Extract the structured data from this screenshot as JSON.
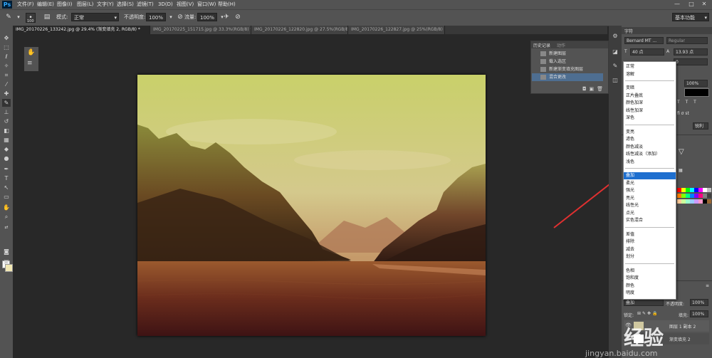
{
  "app": {
    "logo": "Ps"
  },
  "menubar": {
    "items": [
      "文件(F)",
      "编辑(E)",
      "图像(I)",
      "图层(L)",
      "文字(Y)",
      "选择(S)",
      "滤镜(T)",
      "3D(D)",
      "视图(V)",
      "窗口(W)",
      "帮助(H)"
    ],
    "window_buttons": [
      "—",
      "□",
      "✕"
    ]
  },
  "options_bar": {
    "brush_size": "100",
    "mode_label": "模式:",
    "mode_value": "正常",
    "opacity_label": "不透明度:",
    "opacity_value": "100%",
    "flow_label": "流量:",
    "flow_value": "100%",
    "workspace": "基本功能"
  },
  "tabs": [
    {
      "label": "IMG_20170226_133242.jpg @ 29.4% (渐变填充 2, RGB/8) *",
      "active": true
    },
    {
      "label": "IMG_20170225_151715.jpg @ 33.3%(RGB/8) *",
      "active": false
    },
    {
      "label": "IMG_20170226_122820.jpg @ 27.5%(RGB/8) *",
      "active": false
    },
    {
      "label": "IMG_20170226_122827.jpg @ 25%(RGB/8) *",
      "active": false
    }
  ],
  "history_panel": {
    "tabs": [
      "历史记录",
      "动作"
    ],
    "items": [
      {
        "label": "新建图层",
        "selected": false
      },
      {
        "label": "载入选区",
        "selected": false
      },
      {
        "label": "新建渐变填充图层",
        "selected": false
      },
      {
        "label": "混合更改",
        "selected": true
      }
    ]
  },
  "character_panel": {
    "tab": "字符",
    "font_family": "Bernard MT ...",
    "font_style": "Regular",
    "font_size": "40 点",
    "leading": "13.93 点",
    "tracking": "0",
    "scale": "100%",
    "antialias": "锐利"
  },
  "blend_modes": {
    "groups": [
      [
        "正常",
        "溶解"
      ],
      [
        "变暗",
        "正片叠底",
        "颜色加深",
        "线性加深",
        "深色"
      ],
      [
        "变亮",
        "滤色",
        "颜色减淡",
        "线性减淡（添加）",
        "浅色"
      ],
      [
        "叠加",
        "柔光",
        "强光",
        "亮光",
        "线性光",
        "点光",
        "实色混合"
      ],
      [
        "差值",
        "排除",
        "减去",
        "划分"
      ],
      [
        "色相",
        "饱和度",
        "颜色",
        "明度"
      ]
    ],
    "selected": "叠加"
  },
  "layers_panel": {
    "blend_mode": "叠加",
    "opacity_label": "不透明度:",
    "opacity_value": "100%",
    "lock_label": "锁定:",
    "fill_label": "填充:",
    "fill_value": "100%",
    "layers": [
      "图层 1 副本 2",
      "渐变填充 2"
    ]
  },
  "watermark": {
    "text": "经验",
    "subtext": "jingyan.baidu.com"
  },
  "colors": {
    "panel_bg": "#535353",
    "dark_bg": "#282828",
    "selection": "#1e6fcf",
    "history_selected": "#4e6e91",
    "foreground": "#ffffff",
    "background": "#f2e8b4"
  }
}
